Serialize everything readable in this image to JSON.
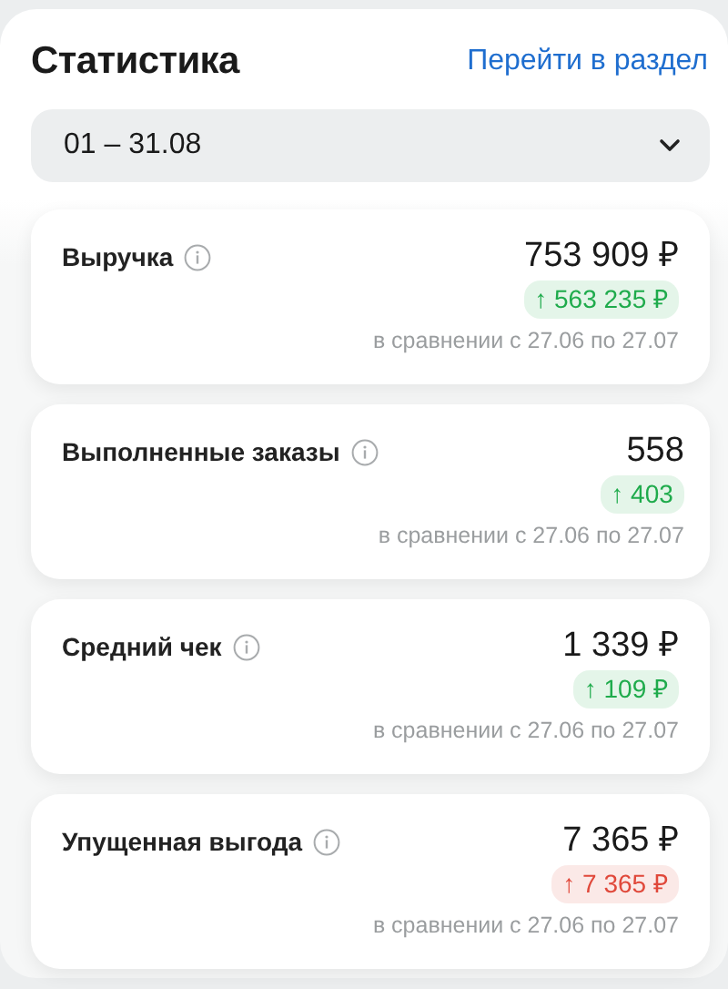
{
  "header": {
    "title": "Статистика",
    "link": "Перейти в раздел"
  },
  "period": {
    "value": "01 – 31.08"
  },
  "metrics": [
    {
      "label": "Выручка",
      "value": "753 909 ₽",
      "delta": "↑ 563 235 ₽",
      "color": "#1fab4c",
      "comparison": "в сравнении с 27.06 по 27.07"
    },
    {
      "label": "Выполненные заказы",
      "value": "558",
      "delta": "↑ 403",
      "color": "#1fab4c",
      "comparison": "в сравнении с 27.06 по 27.07"
    },
    {
      "label": "Средний чек",
      "value": "1 339 ₽",
      "delta": "↑ 109 ₽",
      "color": "#1fab4c",
      "comparison": "в сравнении с 27.06 по 27.07"
    },
    {
      "label": "Упущенная выгода",
      "value": "7 365 ₽",
      "delta": "↑ 7 365 ₽",
      "color": "#e0483a",
      "comparison": "в сравнении с 27.06 по 27.07"
    }
  ]
}
